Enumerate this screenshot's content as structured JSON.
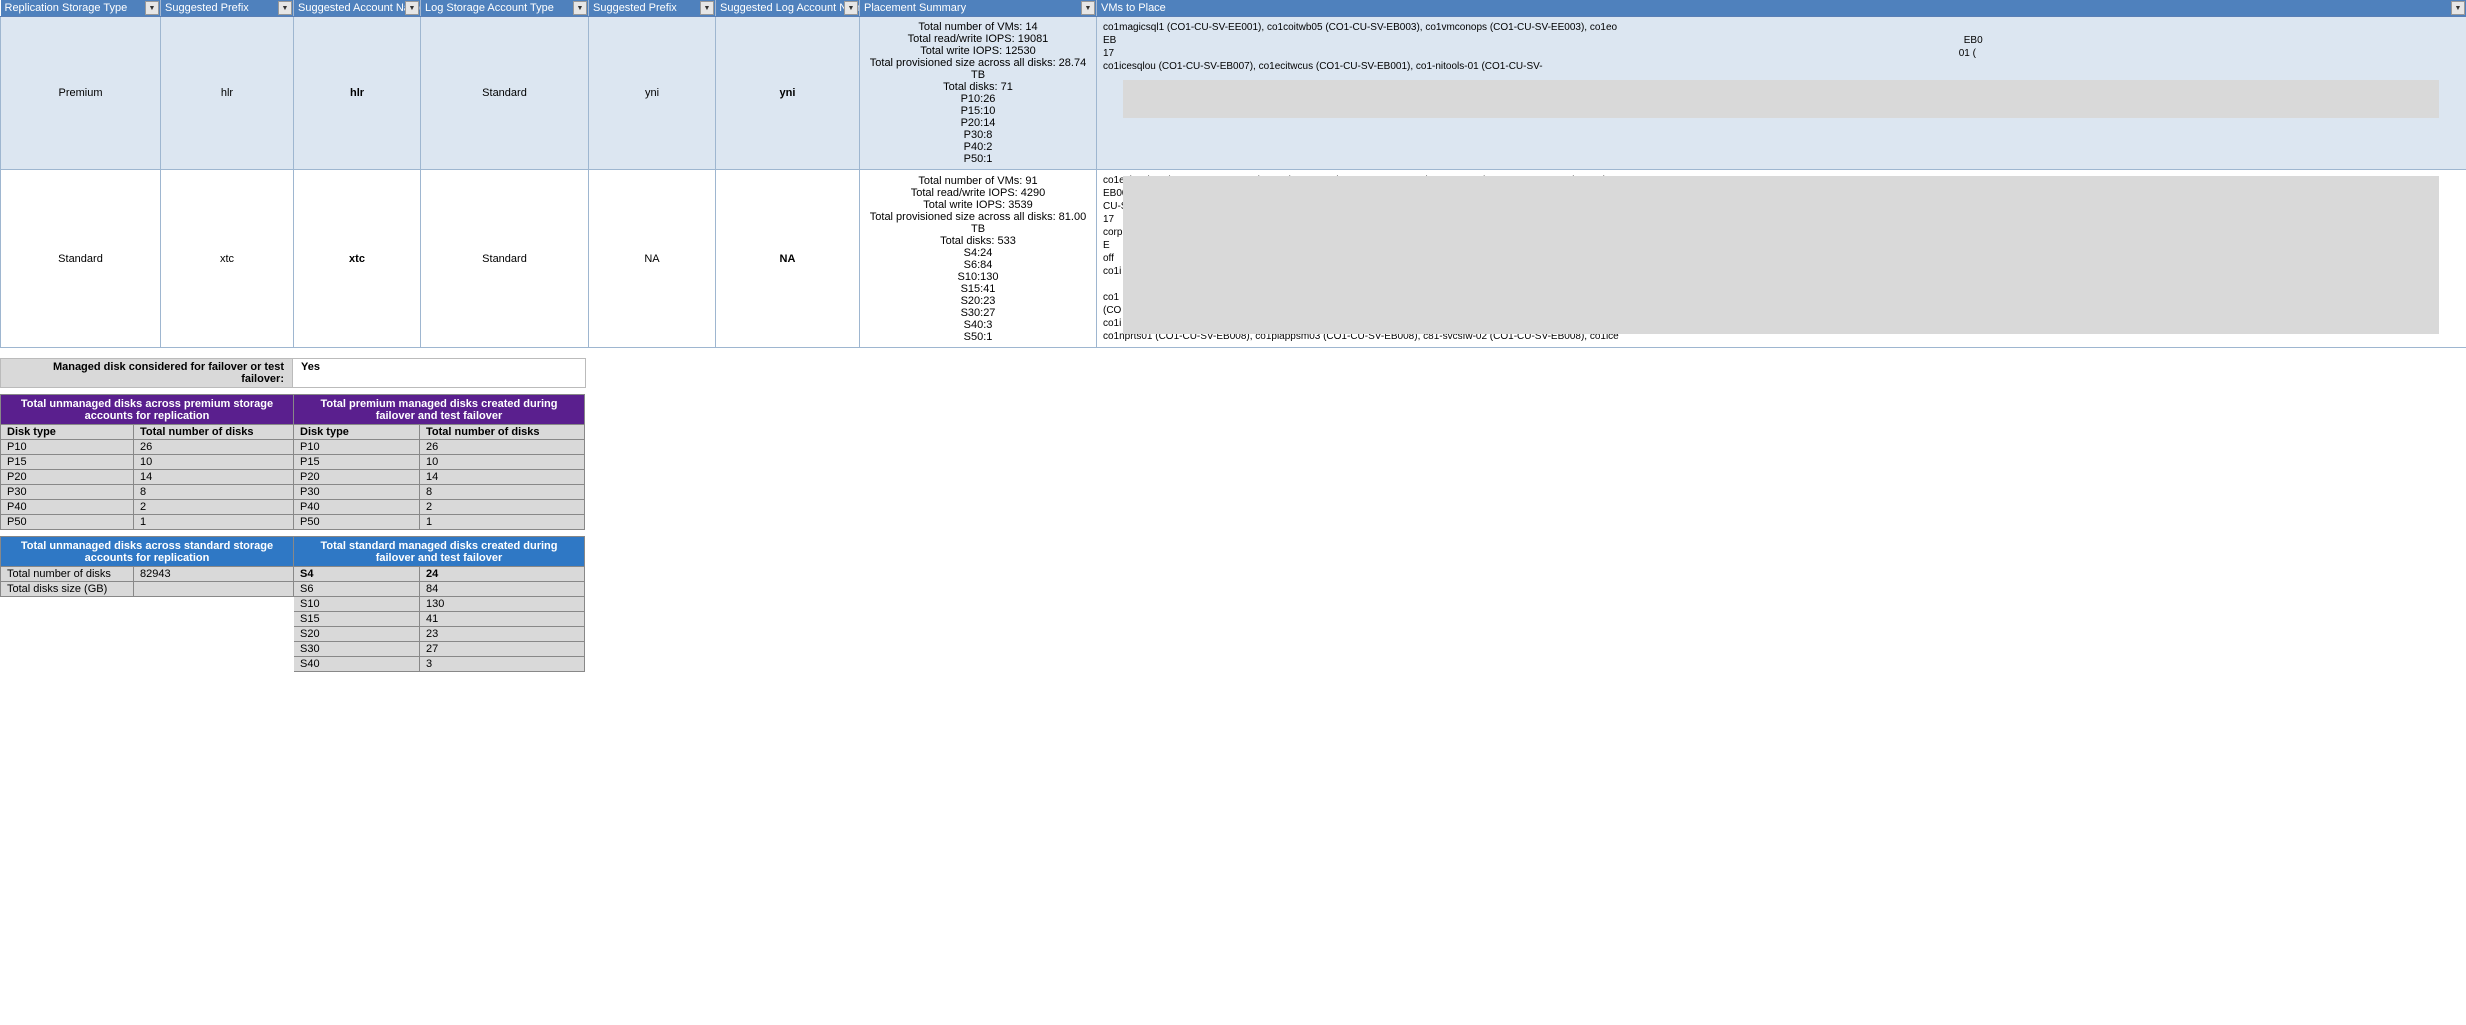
{
  "main": {
    "headers": [
      "Replication Storage Type",
      "Suggested Prefix",
      "Suggested Account Name",
      "Log Storage Account Type",
      "Suggested Prefix",
      "Suggested Log Account  Name",
      "Placement Summary",
      "VMs to Place"
    ],
    "rows": [
      {
        "rep_type": "Premium",
        "prefix1": "hlr",
        "acct": "hlr<premium1>",
        "log_type": "Standard",
        "prefix2": "yni",
        "log_acct": "yni<standard2>",
        "summary": [
          "Total number of VMs: 14",
          "Total read/write IOPS: 19081",
          "Total write IOPS: 12530",
          "Total provisioned size across all disks: 28.74 TB",
          "Total disks: 71",
          "P10:26",
          "P15:10",
          "P20:14",
          "P30:8",
          "P40:2",
          "P50:1"
        ],
        "vms_lines": [
          "co1magicsql1 (CO1-CU-SV-EE001), co1coitwb05 (CO1-CU-SV-EB003), co1vmconops (CO1-CU-SV-EE003), co1eo",
          "EB                                                                                                                                                                                                                                                                                                                 EB0",
          "17                                                                                                                                                                                                                                                                                                                01 (",
          "co1icesqlou (CO1-CU-SV-EB007), co1ecitwcus (CO1-CU-SV-EB001), co1-nitools-01 (CO1-CU-SV-​"
        ]
      },
      {
        "rep_type": "Standard",
        "prefix1": "xtc",
        "acct": "xtc<standard1>",
        "log_type": "Standard",
        "prefix2": "NA",
        "log_acct": "NA",
        "summary": [
          "Total number of VMs: 91",
          "Total read/write IOPS: 4290",
          "Total write IOPS: 3539",
          "Total provisioned size across all disks: 81.00 TB",
          "Total disks: 533",
          "S4:24",
          "S6:84",
          "S10:130",
          "S15:41",
          "S20:23",
          "S30:27",
          "S40:3",
          "S50:1"
        ],
        "vms_lines": [
          "co1ecitwob02 (CO1-CU-SV-EB004), co1niagpsm02 (CO1-CU-SV-EB004), co1u1402 (CO1-CU-SV-EB004), co1xi",
          "EB00                                                                                                                                                                                                                                                                                                            EBO",
          "CU-S                                                                                                                                                                                                                                                                                                          O1-C",
          "17                                                                                                                                                                                                                                                                                                              (CO",
          "corp-                                                                                                                                                                                                                                                                                                          . co1",
          "E                                                                                                                                                                                                                                                                                                            O1-C",
          "off                                                                                                                                                                                                                                                                                                          sql1",
          "co1i                                                                                                                                                                                                                                                                                                         006)",
          "                                                                                                                                                                                                                                                                                                               (CO",
          "co1                                                                                                                                                                                                                                                                                                          V-EE",
          "(CO                                                                                                                                                                                                                                                                                                          xp-0",
          "co1i                                                                                                                                                                                                                                                                                                          7), c",
          "co1nprts01 (CO1-CU-SV-EB008), co1plappsm03 (CO1-CU-SV-EB008), c81-svcsfw-02 (CO1-CU-SV-EB008), co1ice"
        ]
      }
    ]
  },
  "managed": {
    "label": "Managed disk considered for failover or test failover:",
    "value": "Yes"
  },
  "premium_section": {
    "left_header": "Total  unmanaged disks across premium storage accounts for replication",
    "right_header": "Total premium managed disks created during failover and test failover",
    "sub_left_a": "Disk type",
    "sub_left_b": "Total number of disks",
    "sub_right_a": "Disk type",
    "sub_right_b": "Total number of disks",
    "rows": [
      {
        "la": "P10",
        "lb": "26",
        "ra": "P10",
        "rb": "26"
      },
      {
        "la": "P15",
        "lb": "10",
        "ra": "P15",
        "rb": "10"
      },
      {
        "la": "P20",
        "lb": "14",
        "ra": "P20",
        "rb": "14"
      },
      {
        "la": "P30",
        "lb": "8",
        "ra": "P30",
        "rb": "8"
      },
      {
        "la": "P40",
        "lb": "2",
        "ra": "P40",
        "rb": "2"
      },
      {
        "la": "P50",
        "lb": "1",
        "ra": "P50",
        "rb": "1"
      }
    ]
  },
  "standard_section": {
    "left_header": "Total unmanaged disks across standard storage accounts for replication",
    "right_header": "Total standard managed disks created during failover and test failover",
    "left_rows": [
      {
        "a": "Total number of disks",
        "b": "82943"
      },
      {
        "a": "Total disks size (GB)",
        "b": ""
      }
    ],
    "right_first": {
      "a": "S4",
      "b": "24"
    },
    "right_rows": [
      {
        "a": "S6",
        "b": "84"
      },
      {
        "a": "S10",
        "b": "130"
      },
      {
        "a": "S15",
        "b": "41"
      },
      {
        "a": "S20",
        "b": "23"
      },
      {
        "a": "S30",
        "b": "27"
      },
      {
        "a": "S40",
        "b": "3"
      }
    ]
  }
}
